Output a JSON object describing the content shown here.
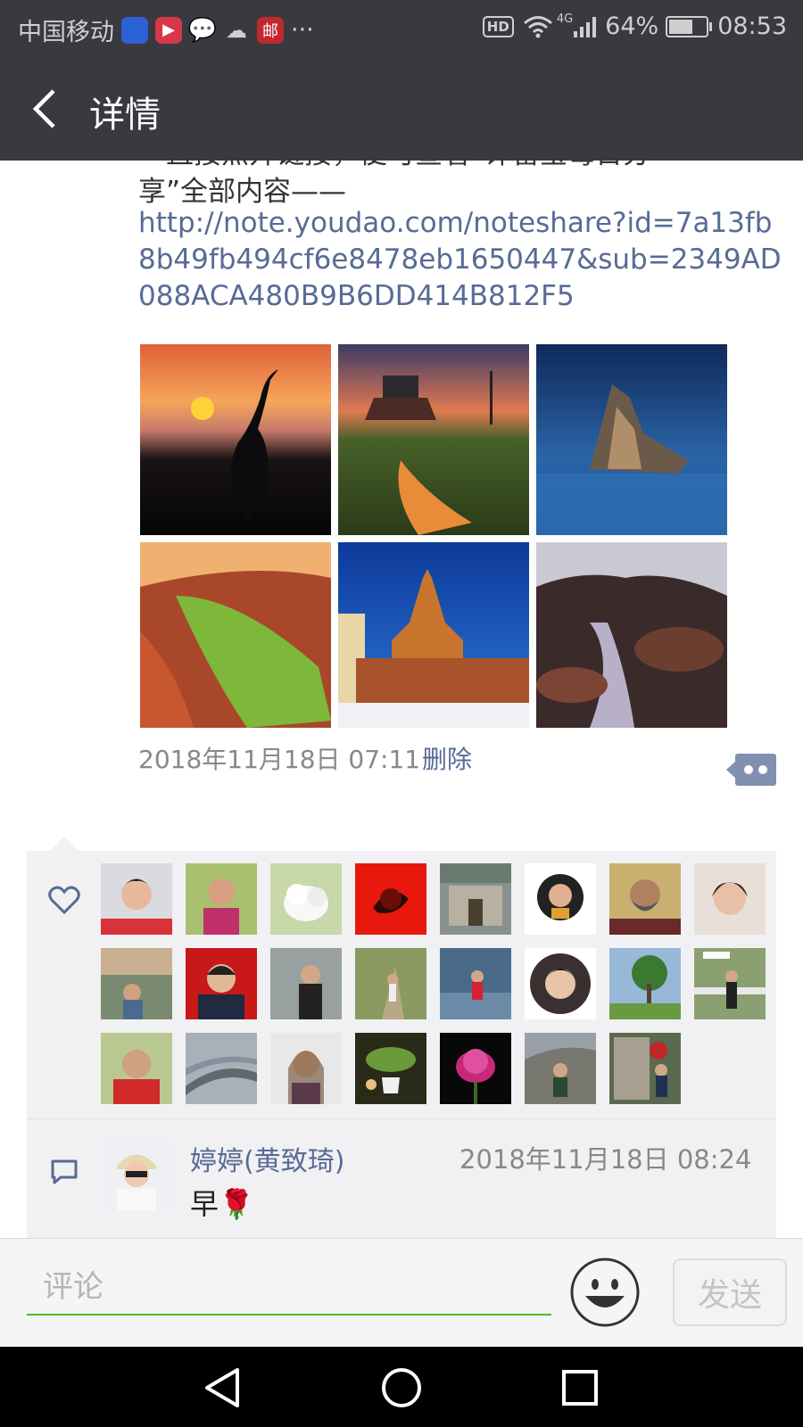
{
  "status_bar": {
    "carrier": "中国移动",
    "more": "···",
    "hd": "HD",
    "network": "4G",
    "battery_percent_text": "64%",
    "battery_level": 0.64,
    "time": "08:53",
    "app_icons": [
      "baidu-paw-icon",
      "video-play-icon",
      "wechat-icon",
      "cloud-download-icon",
      "post-icon"
    ]
  },
  "header": {
    "title": "详情",
    "back_icon": "chevron-left-icon"
  },
  "post": {
    "text_cut_line1": "一直接点开链接，便可查看“评留宝每日分",
    "text_line2": "享”全部内容——",
    "link": "http://note.youdao.com/noteshare?id=7a13fb8b49fb494cf6e8478eb1650447&sub=2349AD088ACA480B9B6DD414B812F5",
    "photos": [
      "crane-sunset",
      "windmill-sunset",
      "ice-rock-lake",
      "green-valley",
      "cathedral-night",
      "waterfall-rocks"
    ],
    "timestamp": "2018年11月18日 07:11",
    "delete_label": "删除"
  },
  "likes": {
    "icon": "heart-icon",
    "count": 23
  },
  "comment": {
    "icon": "comment-bubble-icon",
    "author": "婷婷(黄致琦)",
    "time": "2018年11月18日 08:24",
    "text": "早🌹"
  },
  "input_bar": {
    "placeholder": "评论",
    "send_label": "发送",
    "emoji_icon": "smiley-icon"
  },
  "nav": [
    "back-triangle-icon",
    "home-circle-icon",
    "recents-square-icon"
  ],
  "colors": {
    "header_bg": "#393a3f",
    "link": "#576b95",
    "input_underline": "#45c01a",
    "panel_bg": "#f1f1f3"
  }
}
